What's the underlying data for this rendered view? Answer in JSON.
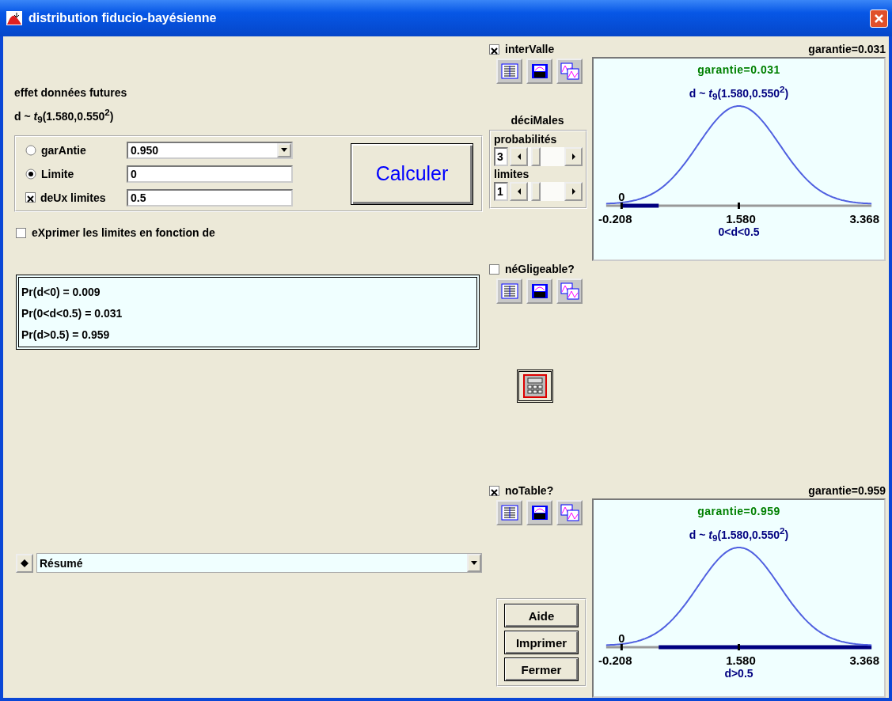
{
  "window": {
    "title": "distribution fiducio-bayésienne"
  },
  "effect": {
    "label": "effet données futures",
    "formula": "d ~ *t*$_{9}$(1.580,0.550$^{2}$)"
  },
  "options": [
    {
      "kind": "radio",
      "label": "garAntie",
      "selected": false,
      "field": {
        "kind": "combo",
        "value": "0.950"
      }
    },
    {
      "kind": "radio",
      "label": "Limite",
      "selected": true,
      "field": {
        "kind": "text",
        "value": "0"
      }
    },
    {
      "kind": "checkbox",
      "label": "deUx limites",
      "checked": true,
      "field": {
        "kind": "text",
        "value": "0.5"
      }
    }
  ],
  "calculate_button": "Calculer",
  "express_checkbox": {
    "label": "eXprimer les limites en fonction de",
    "checked": false
  },
  "results": [
    "Pr(d<0) = 0.009",
    "Pr(0<d<0.5) = 0.031",
    "Pr(d>0.5) = 0.959"
  ],
  "summary_dropdown": {
    "value": "Résumé"
  },
  "decimals": {
    "title": "déciMales",
    "rows": [
      {
        "label": "probabilités",
        "value": "3"
      },
      {
        "label": "limites",
        "value": "1"
      }
    ]
  },
  "panels": [
    {
      "label": "interValle",
      "checked": true,
      "guarantee": "garantie=0.031",
      "chart": {
        "kind": "between",
        "title": "garantie=0.031",
        "formula": "d ~ *t*$_{9}$(1.580,0.550$^{2}$)",
        "zero": "0",
        "ticks": [
          "-0.208",
          "1.580",
          "3.368"
        ],
        "interval": "0<d<0.5"
      }
    },
    {
      "label": "néGligeable?",
      "checked": false
    },
    {
      "label": "noTable?",
      "checked": true,
      "guarantee": "garantie=0.959",
      "chart": {
        "kind": "above",
        "title": "garantie=0.959",
        "formula": "d ~ *t*$_{9}$(1.580,0.550$^{2}$)",
        "zero": "0",
        "ticks": [
          "-0.208",
          "1.580",
          "3.368"
        ],
        "interval": "d>0.5"
      }
    }
  ],
  "buttons": [
    "Aide",
    "Imprimer",
    "Fermer"
  ]
}
